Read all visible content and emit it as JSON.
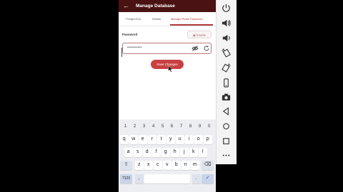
{
  "appbar": {
    "back_icon": "arrow-left-icon",
    "title": "Manage Database"
  },
  "tabs": [
    {
      "label": "PostgreSQL",
      "active": false
    },
    {
      "label": "Details",
      "active": false
    },
    {
      "label": "Manage Redis Password",
      "active": true
    }
  ],
  "form": {
    "password_label": "Password",
    "enable_label": "Enable",
    "password_value": "••••••••••",
    "save_label": "Save Changes"
  },
  "keyboard": {
    "numbers": [
      "1",
      "2",
      "3",
      "4",
      "5",
      "6",
      "7",
      "8",
      "9",
      "0"
    ],
    "row1": [
      "q",
      "w",
      "e",
      "r",
      "t",
      "y",
      "u",
      "i",
      "o",
      "p"
    ],
    "row2": [
      "a",
      "s",
      "d",
      "f",
      "g",
      "h",
      "j",
      "k",
      "l"
    ],
    "row3": [
      "z",
      "x",
      "c",
      "v",
      "b",
      "n",
      "m"
    ],
    "shift_icon": "shift-icon",
    "backspace_icon": "backspace-icon",
    "symbols_label": "?123",
    "comma_label": ",",
    "period_label": ".",
    "enter_icon": "check-icon"
  },
  "emulator_toolbar": [
    "power-icon",
    "volume-up-icon",
    "volume-down-icon",
    "rotate-left-icon",
    "rotate-right-icon",
    "device-icon",
    "camera-icon",
    "back-icon",
    "home-icon",
    "overview-icon",
    "more-icon"
  ],
  "colors": {
    "appbar": "#4a1212",
    "accent": "#b23a3a",
    "save_button": "#c94040"
  }
}
